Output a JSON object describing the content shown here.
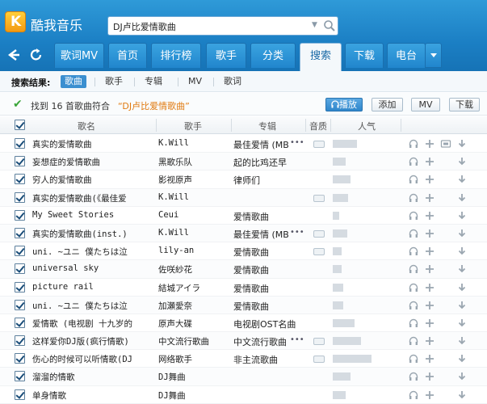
{
  "app": {
    "title": "酷我音乐",
    "logo_letter": "K"
  },
  "search": {
    "value": "DJ卢比爱情歌曲"
  },
  "tabs": [
    {
      "label": "歌词MV"
    },
    {
      "label": "首页"
    },
    {
      "label": "排行榜"
    },
    {
      "label": "歌手"
    },
    {
      "label": "分类"
    },
    {
      "label": "搜索",
      "active": true
    },
    {
      "label": "下载"
    },
    {
      "label": "电台"
    }
  ],
  "filter": {
    "label": "搜索结果:",
    "items": [
      {
        "label": "歌曲",
        "active": true
      },
      {
        "label": "歌手"
      },
      {
        "label": "专辑"
      },
      {
        "label": "MV"
      },
      {
        "label": "歌词"
      }
    ]
  },
  "result": {
    "prefix": "找到 16 首歌曲符合",
    "query": "“DJ卢比爱情歌曲”",
    "buttons": {
      "play": "播放",
      "add": "添加",
      "mv": "MV",
      "download": "下载"
    }
  },
  "columns": {
    "title": "歌名",
    "artist": "歌手",
    "album": "专辑",
    "quality": "音质",
    "popularity": "人气"
  },
  "songs": [
    {
      "title": "真实的爱情歌曲",
      "artist": "K.Will",
      "album": "最佳爱情 (MB",
      "more": true,
      "quality": true,
      "pop": 0.38,
      "video": true
    },
    {
      "title": "妄想症的爱情歌曲",
      "artist": "黑歌乐队",
      "album": "起的比鸡还早",
      "more": false,
      "quality": false,
      "pop": 0.2,
      "video": false
    },
    {
      "title": "穷人的爱情歌曲",
      "artist": "影视原声",
      "album": "律师们",
      "more": false,
      "quality": false,
      "pop": 0.28,
      "video": false
    },
    {
      "title": "真实的爱情歌曲(《最佳爱",
      "artist": "K.Will",
      "album": "",
      "more": false,
      "quality": true,
      "pop": 0.24,
      "video": false
    },
    {
      "title": "My Sweet Stories",
      "artist": "Ceui",
      "album": "爱情歌曲",
      "more": false,
      "quality": false,
      "pop": 0.1,
      "video": false
    },
    {
      "title": "真实的爱情歌曲(inst.)",
      "artist": "K.Will",
      "album": "最佳爱情 (MB",
      "more": true,
      "quality": true,
      "pop": 0.22,
      "video": false
    },
    {
      "title": "uni. ~ユニ 僕たちは泣",
      "artist": "lily-an",
      "album": "爱情歌曲",
      "more": false,
      "quality": true,
      "pop": 0.14,
      "video": false
    },
    {
      "title": "universal sky",
      "artist": "佐咲紗花",
      "album": "爱情歌曲",
      "more": false,
      "quality": false,
      "pop": 0.14,
      "video": false
    },
    {
      "title": "picture rail",
      "artist": "結城アイラ",
      "album": "爱情歌曲",
      "more": false,
      "quality": false,
      "pop": 0.16,
      "video": false
    },
    {
      "title": "uni. ~ユニ 僕たちは泣",
      "artist": "加瀬愛奈",
      "album": "爱情歌曲",
      "more": false,
      "quality": false,
      "pop": 0.16,
      "video": false
    },
    {
      "title": "爱情歌 (电视剧 十九岁的",
      "artist": "原声大碟",
      "album": "电视剧OST名曲",
      "more": false,
      "quality": false,
      "pop": 0.34,
      "video": false
    },
    {
      "title": "这样爱你DJ版(疯行情歌)",
      "artist": "中文流行歌曲",
      "album": "中文流行歌曲",
      "more": true,
      "quality": true,
      "pop": 0.44,
      "video": false
    },
    {
      "title": "伤心的时候可以听情歌(DJ",
      "artist": "网络歌手",
      "album": "非主流歌曲",
      "more": false,
      "quality": true,
      "pop": 0.6,
      "video": false
    },
    {
      "title": "溜溜的情歌",
      "artist": "DJ舞曲",
      "album": "",
      "more": false,
      "quality": false,
      "pop": 0.28,
      "video": false
    },
    {
      "title": "单身情歌",
      "artist": "DJ舞曲",
      "album": "",
      "more": false,
      "quality": false,
      "pop": 0.2,
      "video": false
    }
  ]
}
